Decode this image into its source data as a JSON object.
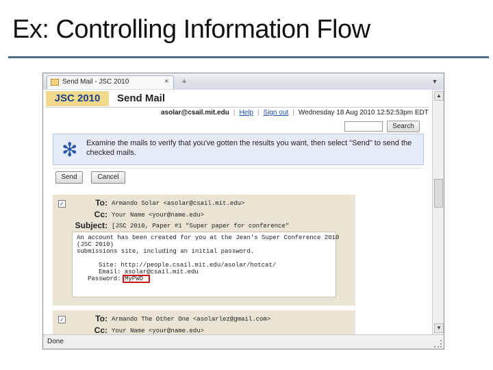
{
  "slide": {
    "title": "Ex: Controlling Information Flow"
  },
  "browser": {
    "tab_title": "Send Mail - JSC 2010",
    "new_tab_glyph": "+",
    "tab_close_glyph": "×",
    "status": "Done"
  },
  "header": {
    "logo": "JSC 2010",
    "title": "Send Mail",
    "user_email": "asolar@csail.mit.edu",
    "help_link": "Help",
    "signout_link": "Sign out",
    "datetime": "Wednesday 18 Aug 2010 12:52:53pm EDT",
    "search_button": "Search",
    "search_value": ""
  },
  "info": {
    "icon": "✻",
    "text": "Examine the mails to verify that you've gotten the results you want, then select \"Send\" to send the checked mails."
  },
  "actions": {
    "send_label": "Send",
    "cancel_label": "Cancel"
  },
  "mails": [
    {
      "checked_glyph": "✓",
      "to_label": "To:",
      "to": "Armando Solar <asolar@csail.mit.edu>",
      "cc_label": "Cc:",
      "cc": "Your Name <your@name.edu>",
      "subject_label": "Subject:",
      "subject": "[JSC 2010, Paper #1 \"Super paper for conference\"",
      "body_lines": [
        "An account has been created for you at the Jean's Super Conference 2010",
        "(JSC 2010)",
        "submissions site, including an initial password.",
        "",
        "    Site: http://people.csail.mit.edu/asolar/hotcat/",
        "   Email: asolar@csail.mit.edu",
        "Password: MyPWD"
      ]
    },
    {
      "checked_glyph": "✓",
      "to_label": "To:",
      "to": "Armando The Other One <asolarlez@gmail.com>",
      "cc_label": "Cc:",
      "cc": "Your Name <your@name.edu>"
    }
  ],
  "colors": {
    "title_rule": "#4a6e8a",
    "logo_bg": "#f1d98c",
    "logo_text": "#1a3f8c",
    "mail_bg": "#e9e4d3",
    "info_bg": "#e5ecf8",
    "highlight": "#c81414"
  }
}
